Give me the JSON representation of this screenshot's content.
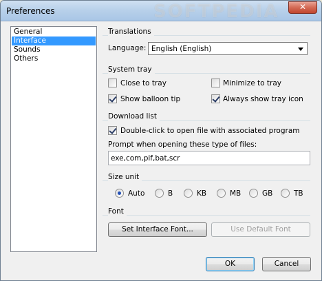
{
  "window": {
    "title": "Preferences",
    "watermark": "SOFTPEDIA",
    "close_glyph": "✕"
  },
  "nav": {
    "items": [
      {
        "label": "General",
        "selected": false
      },
      {
        "label": "Interface",
        "selected": true
      },
      {
        "label": "Sounds",
        "selected": false
      },
      {
        "label": "Others",
        "selected": false
      }
    ]
  },
  "translations": {
    "title": "Translations",
    "language_label": "Language:",
    "language_value": "English (English)"
  },
  "system_tray": {
    "title": "System tray",
    "close_to_tray": {
      "label": "Close to tray",
      "checked": false
    },
    "minimize_to_tray": {
      "label": "Minimize to tray",
      "checked": false
    },
    "show_balloon_tip": {
      "label": "Show balloon tip",
      "checked": true
    },
    "always_show_tray_icon": {
      "label": "Always show tray icon",
      "checked": true
    }
  },
  "download_list": {
    "title": "Download list",
    "double_click": {
      "label": "Double-click to open file with associated program",
      "checked": true
    },
    "prompt_label": "Prompt when opening these type of files:",
    "prompt_value": "exe,com,pif,bat,scr"
  },
  "size_unit": {
    "title": "Size unit",
    "options": [
      "Auto",
      "B",
      "KB",
      "MB",
      "GB",
      "TB"
    ],
    "selected": "Auto"
  },
  "font": {
    "title": "Font",
    "set_button": "Set Interface Font...",
    "default_button": "Use Default Font"
  },
  "footer": {
    "ok": "OK",
    "cancel": "Cancel"
  }
}
